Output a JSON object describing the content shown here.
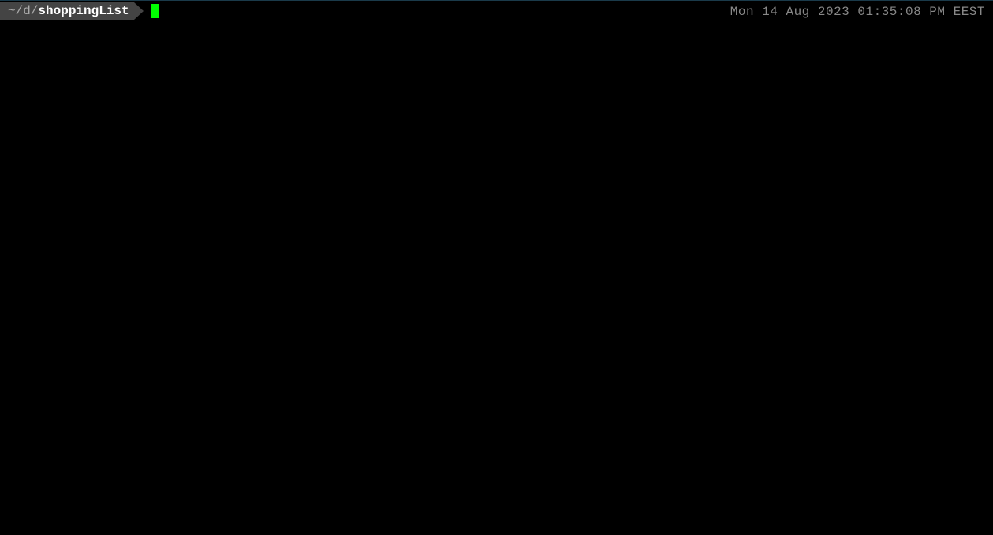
{
  "prompt": {
    "path_prefix": "~/d/",
    "path_current": "shoppingList"
  },
  "datetime": "Mon 14 Aug 2023 01:35:08 PM EEST",
  "colors": {
    "background": "#000000",
    "prompt_bg": "#444444",
    "prompt_dim": "#aaaaaa",
    "prompt_bright": "#ffffff",
    "cursor": "#00ff00",
    "datetime": "#888888"
  }
}
